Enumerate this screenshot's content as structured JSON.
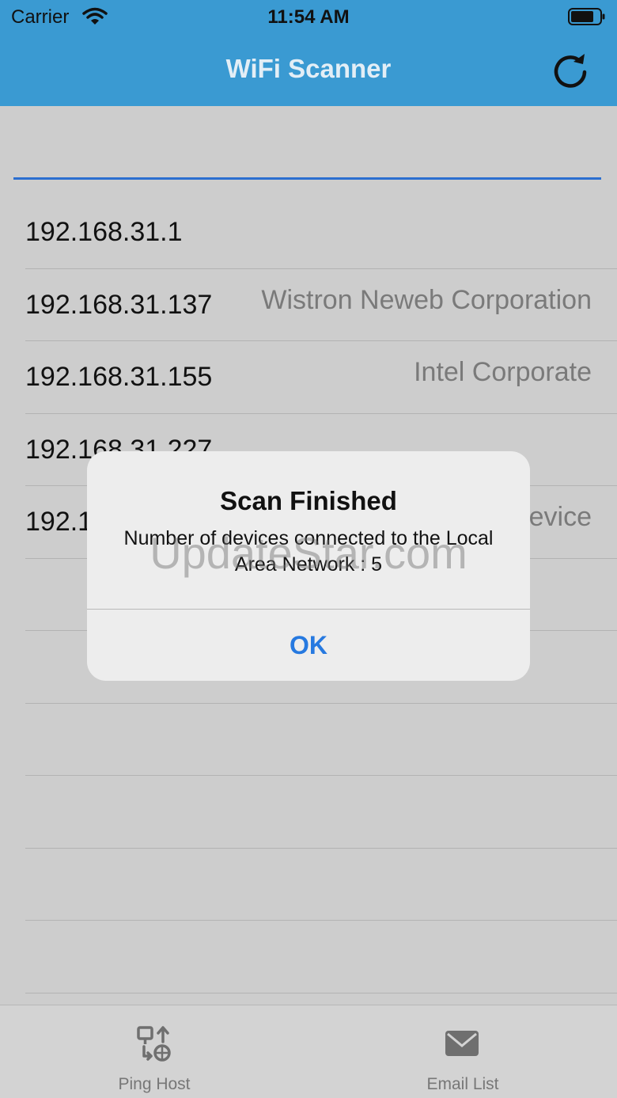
{
  "status_bar": {
    "carrier": "Carrier",
    "time": "11:54 AM",
    "icons": [
      "wifi-icon",
      "battery-icon"
    ]
  },
  "nav": {
    "title": "WiFi Scanner",
    "refresh_icon": "refresh-icon"
  },
  "devices": [
    {
      "ip": "192.168.31.1",
      "vendor": ""
    },
    {
      "ip": "192.168.31.137",
      "vendor": "Wistron Neweb Corporation"
    },
    {
      "ip": "192.168.31.155",
      "vendor": "Intel Corporate"
    },
    {
      "ip": "192.168.31.227",
      "vendor": ""
    },
    {
      "ip": "192.1",
      "vendor": "evice"
    },
    {
      "ip": "",
      "vendor": ""
    },
    {
      "ip": "",
      "vendor": ""
    },
    {
      "ip": "",
      "vendor": ""
    },
    {
      "ip": "",
      "vendor": ""
    },
    {
      "ip": "",
      "vendor": ""
    },
    {
      "ip": "",
      "vendor": ""
    }
  ],
  "dialog": {
    "title": "Scan Finished",
    "message": "Number of devices connected to the Local Area Network : 5",
    "ok_label": "OK"
  },
  "tabs": [
    {
      "label": "Ping Host",
      "icon": "ping-host-icon"
    },
    {
      "label": "Email List",
      "icon": "mail-icon"
    }
  ],
  "watermark": "UpdateStar.com",
  "colors": {
    "nav_bg": "#3a9ad2",
    "accent": "#2679e0",
    "underline": "#2b6fd0"
  }
}
